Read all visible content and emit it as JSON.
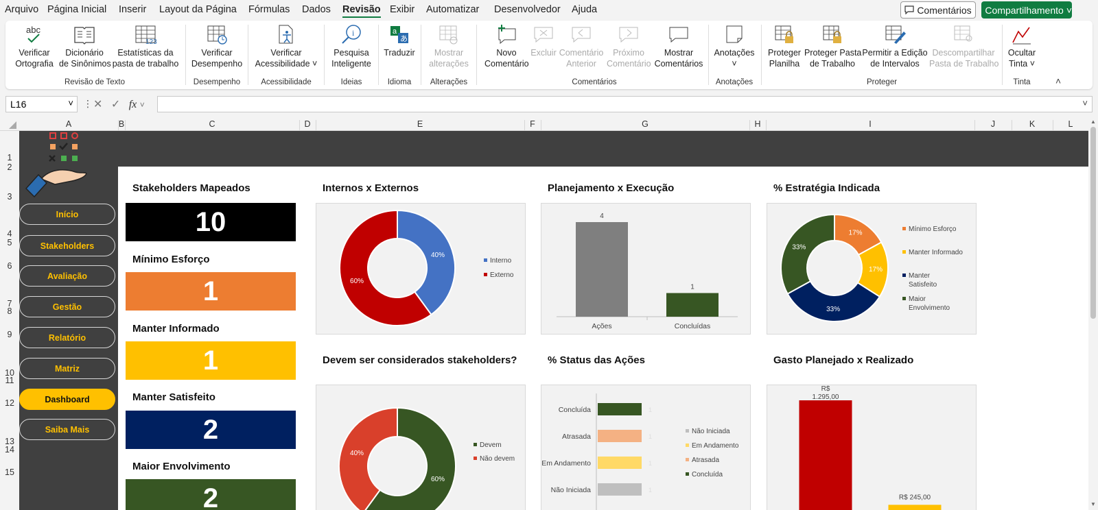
{
  "menu": [
    "Arquivo",
    "Página Inicial",
    "Inserir",
    "Layout da Página",
    "Fórmulas",
    "Dados",
    "Revisão",
    "Exibir",
    "Automatizar",
    "Desenvolvedor",
    "Ajuda"
  ],
  "top_actions": {
    "comments": "Comentários",
    "share": "Compartilhamento"
  },
  "ribbon": {
    "buttons": [
      {
        "l1": "Verificar",
        "l2": "Ortografia",
        "icon": "spellcheck-icon"
      },
      {
        "l1": "Dicionário",
        "l2": "de Sinônimos",
        "icon": "thesaurus-icon"
      },
      {
        "l1": "Estatísticas da",
        "l2": "pasta de trabalho",
        "icon": "workbook-stats-icon"
      },
      {
        "l1": "Verificar",
        "l2": "Desempenho",
        "icon": "performance-icon"
      },
      {
        "l1": "Verificar",
        "l2": "Acessibilidade ˅",
        "icon": "accessibility-icon"
      },
      {
        "l1": "Pesquisa",
        "l2": "Inteligente",
        "icon": "smart-lookup-icon"
      },
      {
        "l1": "Traduzir",
        "l2": "",
        "icon": "translate-icon"
      },
      {
        "l1": "Mostrar",
        "l2": "alterações",
        "icon": "show-changes-icon"
      },
      {
        "l1": "Novo",
        "l2": "Comentário",
        "icon": "new-comment-icon"
      },
      {
        "l1": "Excluir",
        "l2": "",
        "icon": "delete-comment-icon"
      },
      {
        "l1": "Comentário",
        "l2": "Anterior",
        "icon": "previous-comment-icon"
      },
      {
        "l1": "Próximo",
        "l2": "Comentário",
        "icon": "next-comment-icon"
      },
      {
        "l1": "Mostrar",
        "l2": "Comentários",
        "icon": "show-comments-icon"
      },
      {
        "l1": "Anotações",
        "l2": "˅",
        "icon": "notes-icon"
      },
      {
        "l1": "Proteger",
        "l2": "Planilha",
        "icon": "protect-sheet-icon"
      },
      {
        "l1": "Proteger Pasta",
        "l2": "de Trabalho",
        "icon": "protect-workbook-icon"
      },
      {
        "l1": "Permitir a Edição",
        "l2": "de Intervalos",
        "icon": "allow-edit-ranges-icon"
      },
      {
        "l1": "Descompartilhar",
        "l2": "Pasta de Trabalho",
        "icon": "unshare-workbook-icon"
      },
      {
        "l1": "Ocultar",
        "l2": "Tinta ˅",
        "icon": "hide-ink-icon"
      }
    ],
    "groups": [
      "Revisão de Texto",
      "Desempenho",
      "Acessibilidade",
      "Ideias",
      "Idioma",
      "Alterações",
      "Comentários",
      "Anotações",
      "Proteger",
      "Tinta"
    ]
  },
  "namebox": "L16",
  "fx": "fx",
  "columns": [
    "A",
    "B",
    "C",
    "D",
    "E",
    "F",
    "G",
    "H",
    "I",
    "J",
    "K",
    "L"
  ],
  "rows": [
    "1",
    "2",
    "3",
    "4",
    "5",
    "6",
    "7",
    "8",
    "9",
    "10",
    "11",
    "12",
    "13",
    "14",
    "15"
  ],
  "nav": [
    "Início",
    "Stakeholders",
    "Avaliação",
    "Gestão",
    "Relatório",
    "Matriz",
    "Dashboard",
    "Saiba Mais"
  ],
  "nav_active": "Dashboard",
  "kpis": [
    {
      "title": "Stakeholders Mapeados",
      "value": "10",
      "color": "#000000"
    },
    {
      "title": "Mínimo Esforço",
      "value": "1",
      "color": "#ed7d31"
    },
    {
      "title": "Manter Informado",
      "value": "1",
      "color": "#ffc000"
    },
    {
      "title": "Manter Satisfeito",
      "value": "2",
      "color": "#002060"
    },
    {
      "title": "Maior Envolvimento",
      "value": "2",
      "color": "#375623"
    }
  ],
  "chart_titles": {
    "internos": "Internos x Externos",
    "planejamento": "Planejamento x Execução",
    "estrategia": "% Estratégia Indicada",
    "devem": "Devem ser considerados stakeholders?",
    "status": "% Status das Ações",
    "gasto": "Gasto Planejado x Realizado"
  },
  "chart_data": [
    {
      "type": "pie",
      "title": "Internos x Externos",
      "labels": [
        "Interno",
        "Externo"
      ],
      "values": [
        40,
        60
      ],
      "data_labels": [
        "40%",
        "60%"
      ],
      "colors": [
        "#4472c4",
        "#c00000"
      ],
      "legend": "right"
    },
    {
      "type": "bar",
      "title": "Planejamento x Execução",
      "categories": [
        "Ações",
        "Concluídas"
      ],
      "values": [
        4,
        1
      ],
      "colors": [
        "#7f7f7f",
        "#375623"
      ]
    },
    {
      "type": "pie",
      "title": "% Estratégia Indicada",
      "labels": [
        "Mínimo Esforço",
        "Manter Informado",
        "Manter Satisfeito",
        "Maior Envolvimento"
      ],
      "values": [
        17,
        17,
        33,
        33
      ],
      "data_labels": [
        "17%",
        "17%",
        "33%",
        "33%"
      ],
      "colors": [
        "#ed7d31",
        "#ffc000",
        "#002060",
        "#375623"
      ],
      "legend": "right"
    },
    {
      "type": "pie",
      "title": "Devem ser considerados stakeholders?",
      "labels": [
        "Devem",
        "Não devem"
      ],
      "values": [
        60,
        40
      ],
      "data_labels": [
        "60%",
        "40%"
      ],
      "colors": [
        "#375623",
        "#d9402b"
      ],
      "legend": "right"
    },
    {
      "type": "bar",
      "title": "% Status das Ações",
      "orientation": "horizontal",
      "categories": [
        "Concluída",
        "Atrasada",
        "Em Andamento",
        "Não Iniciada"
      ],
      "values": [
        1,
        1,
        1,
        1
      ],
      "colors": [
        "#375623",
        "#f4b183",
        "#ffd966",
        "#bfbfbf"
      ],
      "legend_labels": [
        "Não Iniciada",
        "Em Andamento",
        "Atrasada",
        "Concluída"
      ],
      "legend": "right"
    },
    {
      "type": "bar",
      "title": "Gasto Planejado x Realizado",
      "values": [
        1295,
        245
      ],
      "data_labels": [
        "R$ 1.295,00",
        "R$ 245,00"
      ],
      "colors": [
        "#c00000",
        "#ffc000"
      ]
    }
  ]
}
